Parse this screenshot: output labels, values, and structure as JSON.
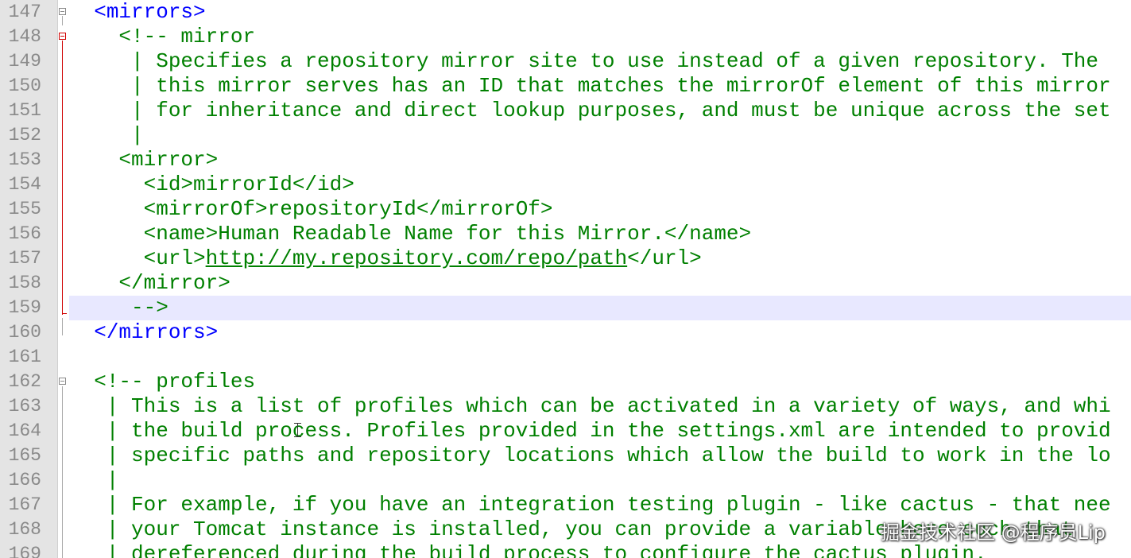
{
  "editor": {
    "lines": [
      {
        "num": "147",
        "segments": [
          {
            "t": "  ",
            "c": "plain"
          },
          {
            "t": "<mirrors>",
            "c": "tag"
          }
        ]
      },
      {
        "num": "148",
        "segments": [
          {
            "t": "    ",
            "c": "plain"
          },
          {
            "t": "<!-- mirror",
            "c": "cmt"
          }
        ]
      },
      {
        "num": "149",
        "segments": [
          {
            "t": "     | Specifies a repository mirror site to use instead of a given repository. The",
            "c": "cmt"
          }
        ]
      },
      {
        "num": "150",
        "segments": [
          {
            "t": "     | this mirror serves has an ID that matches the mirrorOf element of this mirror",
            "c": "cmt"
          }
        ]
      },
      {
        "num": "151",
        "segments": [
          {
            "t": "     | for inheritance and direct lookup purposes, and must be unique across the set",
            "c": "cmt"
          }
        ]
      },
      {
        "num": "152",
        "segments": [
          {
            "t": "     |",
            "c": "cmt"
          }
        ]
      },
      {
        "num": "153",
        "segments": [
          {
            "t": "    <mirror>",
            "c": "cmt"
          }
        ]
      },
      {
        "num": "154",
        "segments": [
          {
            "t": "      <id>mirrorId</id>",
            "c": "cmt"
          }
        ]
      },
      {
        "num": "155",
        "segments": [
          {
            "t": "      <mirrorOf>repositoryId</mirrorOf>",
            "c": "cmt"
          }
        ]
      },
      {
        "num": "156",
        "segments": [
          {
            "t": "      <name>Human Readable Name for this Mirror.</name>",
            "c": "cmt"
          }
        ]
      },
      {
        "num": "157",
        "segments": [
          {
            "t": "      <url>",
            "c": "cmt"
          },
          {
            "t": "http://my.repository.com/repo/path",
            "c": "link"
          },
          {
            "t": "</url>",
            "c": "cmt"
          }
        ]
      },
      {
        "num": "158",
        "segments": [
          {
            "t": "    </mirror>",
            "c": "cmt"
          }
        ]
      },
      {
        "num": "159",
        "segments": [
          {
            "t": "     -->",
            "c": "cmt"
          }
        ]
      },
      {
        "num": "160",
        "segments": [
          {
            "t": "  ",
            "c": "plain"
          },
          {
            "t": "</mirrors>",
            "c": "tag"
          }
        ]
      },
      {
        "num": "161",
        "segments": []
      },
      {
        "num": "162",
        "segments": [
          {
            "t": "  ",
            "c": "plain"
          },
          {
            "t": "<!-- profiles",
            "c": "cmt"
          }
        ]
      },
      {
        "num": "163",
        "segments": [
          {
            "t": "   | This is a list of profiles which can be activated in a variety of ways, and whi",
            "c": "cmt"
          }
        ]
      },
      {
        "num": "164",
        "segments": [
          {
            "t": "   | the build process. Profiles provided in the settings.xml are intended to provid",
            "c": "cmt"
          }
        ]
      },
      {
        "num": "165",
        "segments": [
          {
            "t": "   | specific paths and repository locations which allow the build to work in the lo",
            "c": "cmt"
          }
        ]
      },
      {
        "num": "166",
        "segments": [
          {
            "t": "   |",
            "c": "cmt"
          }
        ]
      },
      {
        "num": "167",
        "segments": [
          {
            "t": "   | For example, if you have an integration testing plugin - like cactus - that nee",
            "c": "cmt"
          }
        ]
      },
      {
        "num": "168",
        "segments": [
          {
            "t": "   | your Tomcat instance is installed, you can provide a variable here such that",
            "c": "cmt"
          }
        ]
      },
      {
        "num": "169",
        "segments": [
          {
            "t": "   | dereferenced during the build process to configure the cactus plugin.",
            "c": "cmt"
          }
        ]
      }
    ],
    "current_line": "159",
    "colors": {
      "tag": "#0000ff",
      "comment": "#008000",
      "line_number": "#8a8a8a",
      "current_line_bg": "#e8e8ff",
      "change_marker": "#d00000"
    }
  },
  "watermark": "掘金技术社区 @程序员Lip"
}
